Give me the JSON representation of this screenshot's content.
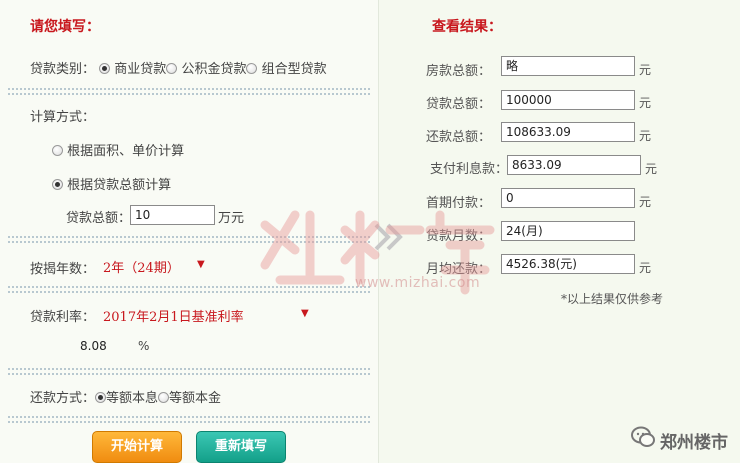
{
  "left": {
    "heading": "请您填写：",
    "loan_type": {
      "label": "贷款类别：",
      "options": [
        "商业贷款",
        "公积金贷款",
        "组合型贷款"
      ],
      "selected": "商业贷款"
    },
    "calc_method": {
      "label": "计算方式：",
      "options": [
        "根据面积、单价计算",
        "根据贷款总额计算"
      ],
      "selected": "根据贷款总额计算"
    },
    "loan_amount": {
      "label": "贷款总额：",
      "value": "10",
      "unit": "万元"
    },
    "years": {
      "label": "按揭年数：",
      "value": "2年（24期）"
    },
    "rate": {
      "label": "贷款利率：",
      "value": "2017年2月1日基准利率",
      "number": "8.08",
      "unit": "%"
    },
    "repay_method": {
      "label": "还款方式：",
      "options": [
        "等额本息",
        "等额本金"
      ],
      "selected": "等额本息"
    },
    "buttons": {
      "start": "开始计算",
      "reset": "重新填写"
    }
  },
  "right": {
    "heading": "查看结果：",
    "rows": [
      {
        "label": "房款总额：",
        "value": "略",
        "unit": "元"
      },
      {
        "label": "贷款总额：",
        "value": "100000",
        "unit": "元"
      },
      {
        "label": "还款总额：",
        "value": "108633.09",
        "unit": "元"
      },
      {
        "label": "支付利息款：",
        "value": "8633.09",
        "unit": "元"
      },
      {
        "label": "首期付款：",
        "value": "0",
        "unit": "元"
      },
      {
        "label": "贷款月数：",
        "value": "24(月)",
        "unit": ""
      },
      {
        "label": "月均还款：",
        "value": "4526.38(元)",
        "unit": "元"
      }
    ],
    "note": "*以上结果仅供参考"
  },
  "watermark": {
    "text": "www.mizhai.com"
  },
  "logo": {
    "text": "郑州楼市"
  }
}
